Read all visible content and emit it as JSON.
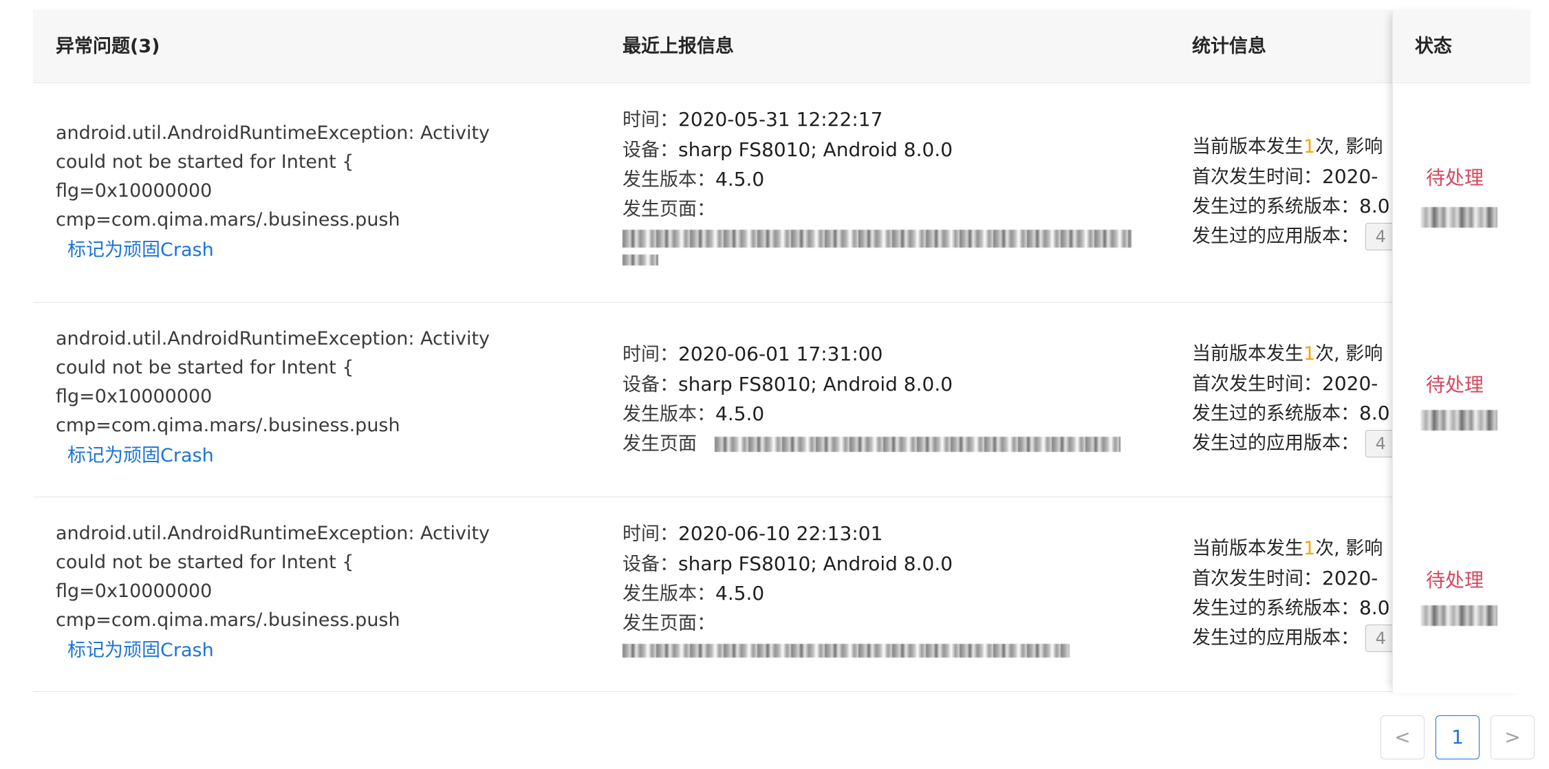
{
  "header": {
    "issue": "异常问题(3)",
    "report": "最近上报信息",
    "stats": "统计信息",
    "status": "状态"
  },
  "rows": [
    {
      "issue_lines": [
        "android.util.AndroidRuntimeException: Activity",
        "could not be started for Intent {",
        "flg=0x10000000",
        "cmp=com.qima.mars/.business.push"
      ],
      "mark_label": "标记为顽固Crash",
      "time_label": "时间：",
      "time": "2020-05-31 12:22:17",
      "device_label": "设备：",
      "device": "sharp FS8010; Android 8.0.0",
      "version_label": "发生版本：",
      "version": "4.5.0",
      "page_label": "发生页面：",
      "stat_current_pre": "当前版本发生",
      "stat_count": "1",
      "stat_current_post": "次, 影响",
      "stat_first_label": "首次发生时间：",
      "stat_first_value": "2020-",
      "stat_os_label": "发生过的系统版本：",
      "stat_os_value": "8.0",
      "stat_app_label": "发生过的应用版本：",
      "stat_app_tag": "4",
      "status": "待处理"
    },
    {
      "issue_lines": [
        "android.util.AndroidRuntimeException: Activity",
        "could not be started for Intent {",
        "flg=0x10000000",
        "cmp=com.qima.mars/.business.push"
      ],
      "mark_label": "标记为顽固Crash",
      "time_label": "时间：",
      "time": "2020-06-01 17:31:00",
      "device_label": "设备：",
      "device": "sharp FS8010; Android 8.0.0",
      "version_label": "发生版本：",
      "version": "4.5.0",
      "page_label": "发生页面",
      "stat_current_pre": "当前版本发生",
      "stat_count": "1",
      "stat_current_post": "次, 影响",
      "stat_first_label": "首次发生时间：",
      "stat_first_value": "2020-",
      "stat_os_label": "发生过的系统版本：",
      "stat_os_value": "8.0",
      "stat_app_label": "发生过的应用版本：",
      "stat_app_tag": "4",
      "status": "待处理"
    },
    {
      "issue_lines": [
        "android.util.AndroidRuntimeException: Activity",
        "could not be started for Intent {",
        "flg=0x10000000",
        "cmp=com.qima.mars/.business.push"
      ],
      "mark_label": "标记为顽固Crash",
      "time_label": "时间：",
      "time": "2020-06-10 22:13:01",
      "device_label": "设备：",
      "device": "sharp FS8010; Android 8.0.0",
      "version_label": "发生版本：",
      "version": "4.5.0",
      "page_label": "发生页面：",
      "stat_current_pre": "当前版本发生",
      "stat_count": "1",
      "stat_current_post": "次, 影响",
      "stat_first_label": "首次发生时间：",
      "stat_first_value": "2020-",
      "stat_os_label": "发生过的系统版本：",
      "stat_os_value": "8.0",
      "stat_app_label": "发生过的应用版本：",
      "stat_app_tag": "4",
      "status": "待处理"
    }
  ],
  "pagination": {
    "prev": "<",
    "page": "1",
    "next": ">"
  },
  "colors": {
    "link": "#1a73d8",
    "status": "#d6485e",
    "highlight": "#f2a900"
  }
}
